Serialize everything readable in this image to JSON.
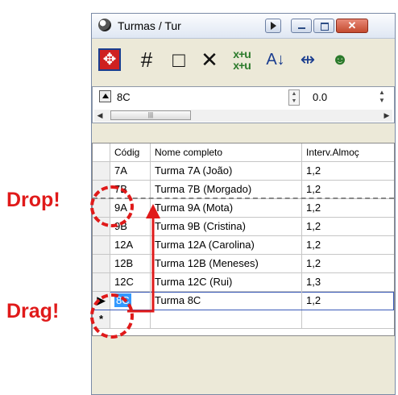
{
  "window": {
    "title": "Turmas / Tur",
    "close_glyph": "✕"
  },
  "toolbar": {
    "icons": [
      "move-icon",
      "grid-icon",
      "new-document-icon",
      "delete-icon",
      "recalculate-icon",
      "sort-icon",
      "columns-icon",
      "users-icon"
    ]
  },
  "record_panel": {
    "field_value": "8C",
    "numeric_value": "0.0"
  },
  "grid": {
    "columns": [
      "Códig",
      "Nome completo",
      "Interv.Almoç"
    ],
    "rows": [
      {
        "code": "7A",
        "name": "Turma 7A (João)",
        "interval": "1,2"
      },
      {
        "code": "7B",
        "name": "Turma 7B (Morgado)",
        "interval": "1,2"
      },
      {
        "code": "9A",
        "name": "Turma 9A (Mota)",
        "interval": "1,2"
      },
      {
        "code": "9B",
        "name": "Turma 9B (Cristina)",
        "interval": "1,2"
      },
      {
        "code": "12A",
        "name": "Turma 12A (Carolina)",
        "interval": "1,2"
      },
      {
        "code": "12B",
        "name": "Turma 12B (Meneses)",
        "interval": "1,2"
      },
      {
        "code": "12C",
        "name": "Turma 12C (Rui)",
        "interval": "1,3"
      },
      {
        "code": "8C",
        "name": "Turma 8C",
        "interval": "1,2"
      }
    ],
    "new_row_marker": "*"
  },
  "annotations": {
    "drop_label": "Drop!",
    "drag_label": "Drag!",
    "color": "#e01a1a"
  }
}
